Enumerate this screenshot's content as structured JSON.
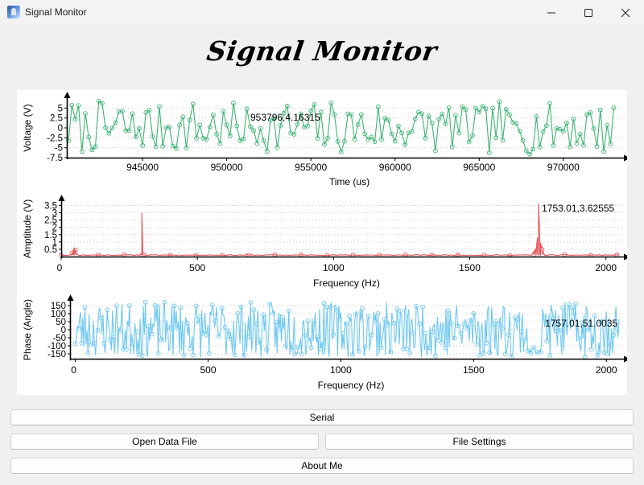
{
  "window": {
    "title": "Signal Monitor"
  },
  "heading": "Signal Monitor",
  "buttons": {
    "serial": "Serial",
    "open_data_file": "Open Data File",
    "file_settings": "File Settings",
    "about_me": "About Me"
  },
  "chart_data": [
    {
      "type": "line",
      "xlabel": "Time (us)",
      "ylabel": "Voltage (V)",
      "xlim": [
        940500,
        973500
      ],
      "ylim": [
        -7.5,
        7.5
      ],
      "x_ticks": [
        945000,
        950000,
        955000,
        960000,
        965000,
        970000
      ],
      "y_ticks": [
        -7.5,
        -5,
        -2.5,
        0,
        2.5,
        5
      ],
      "y_tick_labels": [
        "-7.5",
        "-5",
        "-2.5",
        "0",
        "2.5",
        "5"
      ],
      "color": "#3cb371",
      "grid": "horizontal dotted",
      "cursor_label": "953796,4.16315",
      "cursor": [
        953796,
        4.16315
      ],
      "x_start": 940600,
      "x_step": 200,
      "num_points": 163,
      "series_description": "noisy signal oscillating roughly between -7.5 V and 7 V"
    },
    {
      "type": "line",
      "xlabel": "Frequency (Hz)",
      "ylabel": "Amptitude (V)",
      "xlim": [
        0,
        2060
      ],
      "ylim": [
        0,
        3.8
      ],
      "x_ticks": [
        0,
        500,
        1000,
        1500,
        2000
      ],
      "y_ticks": [
        0.5,
        1,
        1.5,
        2,
        2.5,
        3,
        3.5
      ],
      "y_tick_labels": [
        "0.5",
        "1",
        "1.5",
        "2",
        "2.5",
        "3",
        "3.5"
      ],
      "color": "#e8555a",
      "grid": "horizontal dotted",
      "cursor_label": "1753.01,3.62555",
      "cursor": [
        1753.01,
        3.62555
      ],
      "peaks": [
        {
          "x": 48,
          "y": 0.62
        },
        {
          "x": 296,
          "y": 3.0
        },
        {
          "x": 1753.01,
          "y": 3.62555
        }
      ],
      "baseline": 0.12,
      "series_description": "amplitude spectrum, near zero baseline with three peaks"
    },
    {
      "type": "line",
      "xlabel": "Frequency (Hz)",
      "ylabel": "Phase (Angle)",
      "xlim": [
        -20,
        2060
      ],
      "ylim": [
        -180,
        180
      ],
      "x_ticks": [
        0,
        500,
        1000,
        1500,
        2000
      ],
      "y_ticks": [
        -150,
        -100,
        -50,
        0,
        50,
        100,
        150
      ],
      "y_tick_labels": [
        "-150",
        "-100",
        "-50",
        "0",
        "50",
        "100",
        "150"
      ],
      "color": "#6ec8f0",
      "grid": "horizontal dotted",
      "cursor_label": "1757.01,51.0035",
      "cursor": [
        1757.01,
        51.0035
      ],
      "series_description": "phase spectrum, random values between -180 and 180 degrees"
    }
  ]
}
